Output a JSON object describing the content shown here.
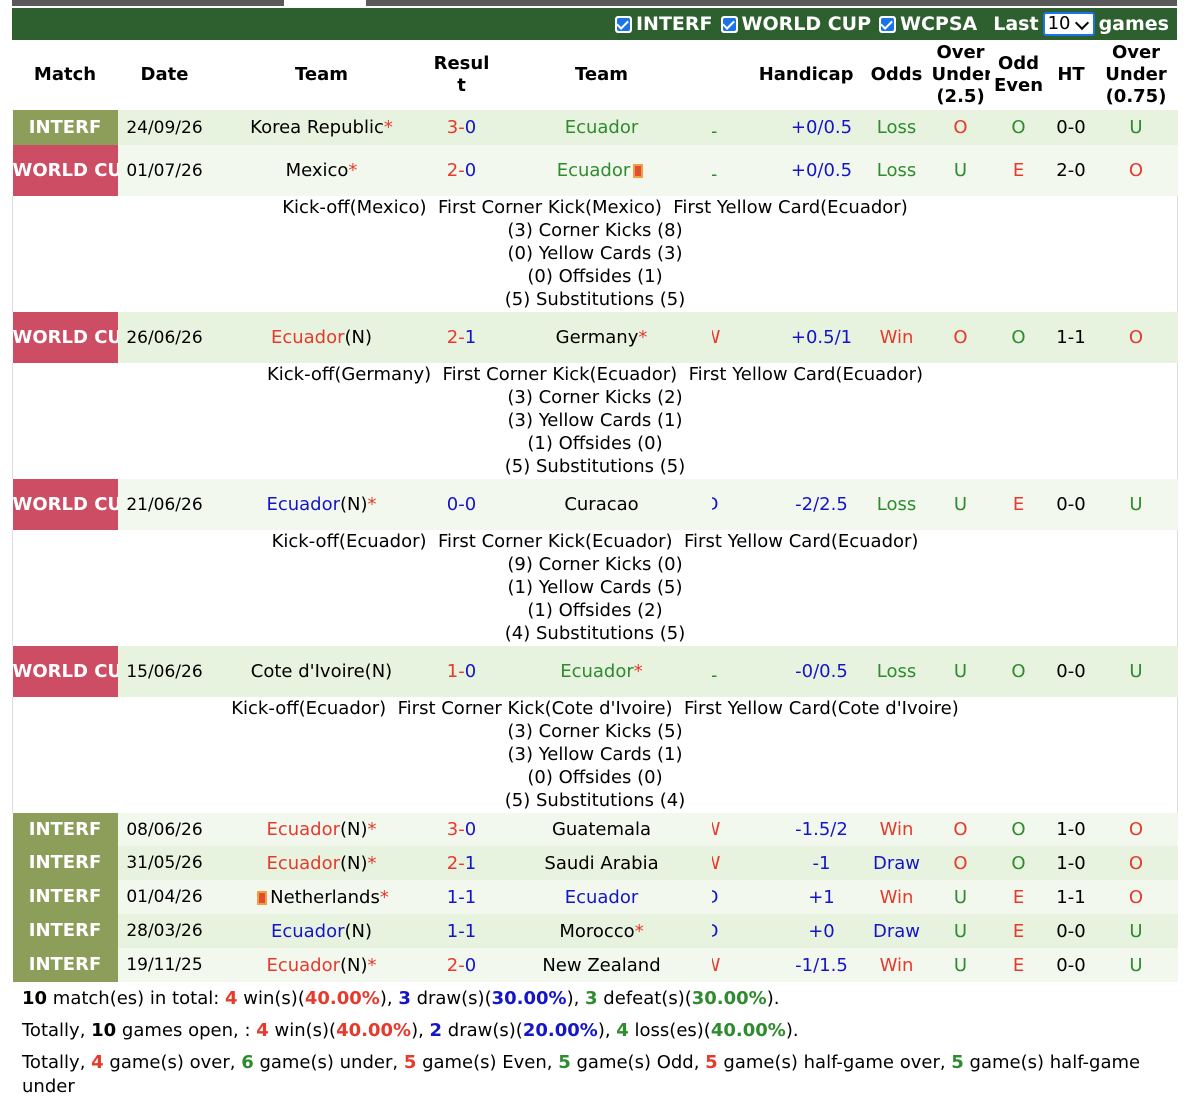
{
  "filters": {
    "items": [
      {
        "label": "INTERF",
        "checked": true
      },
      {
        "label": "WORLD CUP",
        "checked": true
      },
      {
        "label": "WCPSA",
        "checked": true
      }
    ],
    "last_label": "Last",
    "games_count": "10",
    "games_label": "games"
  },
  "headers": {
    "match": "Match",
    "date": "Date",
    "team1": "Team",
    "result": "Resul t",
    "team2": "Team",
    "handicap": "Handicap",
    "odds": "Odds",
    "ou25": "Over Under (2.5)",
    "oddeven": "Odd Even",
    "ht": "HT",
    "ou075": "Over Under (0.75)"
  },
  "rows": [
    {
      "comp": "INTERF",
      "date": "24/09/26",
      "team1": "Korea Republic",
      "team1_star": "*",
      "team1_suffix": "",
      "score_home": "3",
      "score_sep": "-",
      "score_away": "0",
      "team2": "Ecuador",
      "team2_star": "",
      "team2_suffix": "",
      "wl": "L",
      "handicap": "+0/0.5",
      "odds": "Loss",
      "ou": "O",
      "oe": "O",
      "ht": "0-0",
      "ou2": "U",
      "detail": null
    },
    {
      "comp": "WORLD CUP",
      "date": "01/07/26",
      "team1": "Mexico",
      "team1_star": "*",
      "team1_suffix": "",
      "score_home": "2",
      "score_sep": "-",
      "score_away": "0",
      "team2": "Ecuador",
      "team2_star": "",
      "team2_suffix": "",
      "wl": "L",
      "handicap": "+0/0.5",
      "odds": "Loss",
      "ou": "U",
      "oe": "E",
      "ht": "2-0",
      "ou2": "O",
      "detail": [
        "Kick-off(Mexico)  First Corner Kick(Mexico)  First Yellow Card(Ecuador)",
        "(3) Corner Kicks (8)",
        "(0) Yellow Cards (3)",
        "(0) Offsides (1)",
        "(5) Substitutions (5)"
      ]
    },
    {
      "comp": "WORLD CUP",
      "date": "26/06/26",
      "team1": "Ecuador",
      "team1_star": "",
      "team1_suffix": "(N)",
      "score_home": "2",
      "score_sep": "-",
      "score_away": "1",
      "team2": "Germany",
      "team2_star": "*",
      "team2_suffix": "",
      "wl": "W",
      "handicap": "+0.5/1",
      "odds": "Win",
      "ou": "O",
      "oe": "O",
      "ht": "1-1",
      "ou2": "O",
      "detail": [
        "Kick-off(Germany)  First Corner Kick(Ecuador)  First Yellow Card(Ecuador)",
        "(3) Corner Kicks (2)",
        "(3) Yellow Cards (1)",
        "(1) Offsides (0)",
        "(5) Substitutions (5)"
      ]
    },
    {
      "comp": "WORLD CUP",
      "date": "21/06/26",
      "team1": "Ecuador",
      "team1_star": "*",
      "team1_suffix": "(N)",
      "score_home": "0",
      "score_sep": "-",
      "score_away": "0",
      "team2": "Curacao",
      "team2_star": "",
      "team2_suffix": "",
      "wl": "D",
      "handicap": "-2/2.5",
      "odds": "Loss",
      "ou": "U",
      "oe": "E",
      "ht": "0-0",
      "ou2": "U",
      "detail": [
        "Kick-off(Ecuador)  First Corner Kick(Ecuador)  First Yellow Card(Ecuador)",
        "(9) Corner Kicks (0)",
        "(1) Yellow Cards (5)",
        "(1) Offsides (2)",
        "(4) Substitutions (5)"
      ]
    },
    {
      "comp": "WORLD CUP",
      "date": "15/06/26",
      "team1": "Cote d'Ivoire",
      "team1_star": "",
      "team1_suffix": "(N)",
      "score_home": "1",
      "score_sep": "-",
      "score_away": "0",
      "team2": "Ecuador",
      "team2_star": "*",
      "team2_suffix": "",
      "wl": "L",
      "handicap": "-0/0.5",
      "odds": "Loss",
      "ou": "U",
      "oe": "O",
      "ht": "0-0",
      "ou2": "U",
      "detail": [
        "Kick-off(Ecuador)  First Corner Kick(Cote d'Ivoire)  First Yellow Card(Cote d'Ivoire)",
        "(3) Corner Kicks (5)",
        "(3) Yellow Cards (1)",
        "(0) Offsides (0)",
        "(5) Substitutions (4)"
      ]
    },
    {
      "comp": "INTERF",
      "date": "08/06/26",
      "team1": "Ecuador",
      "team1_star": "*",
      "team1_suffix": "(N)",
      "score_home": "3",
      "score_sep": "-",
      "score_away": "0",
      "team2": "Guatemala",
      "team2_star": "",
      "team2_suffix": "",
      "wl": "W",
      "handicap": "-1.5/2",
      "odds": "Win",
      "ou": "O",
      "oe": "O",
      "ht": "1-0",
      "ou2": "O",
      "detail": null
    },
    {
      "comp": "INTERF",
      "date": "31/05/26",
      "team1": "Ecuador",
      "team1_star": "*",
      "team1_suffix": "(N)",
      "score_home": "2",
      "score_sep": "-",
      "score_away": "1",
      "team2": "Saudi Arabia",
      "team2_star": "",
      "team2_suffix": "",
      "wl": "W",
      "handicap": "-1",
      "odds": "Draw",
      "ou": "O",
      "oe": "O",
      "ht": "1-0",
      "ou2": "O",
      "detail": null
    },
    {
      "comp": "INTERF",
      "date": "01/04/26",
      "team1": "Netherlands",
      "team1_star": "*",
      "team1_suffix": "",
      "score_home": "1",
      "score_sep": "-",
      "score_away": "1",
      "team2": "Ecuador",
      "team2_star": "",
      "team2_suffix": "",
      "wl": "D",
      "handicap": "+1",
      "odds": "Win",
      "ou": "U",
      "oe": "E",
      "ht": "1-1",
      "ou2": "O",
      "detail": null
    },
    {
      "comp": "INTERF",
      "date": "28/03/26",
      "team1": "Ecuador",
      "team1_star": "",
      "team1_suffix": "(N)",
      "score_home": "1",
      "score_sep": "-",
      "score_away": "1",
      "team2": "Morocco",
      "team2_star": "*",
      "team2_suffix": "",
      "wl": "D",
      "handicap": "+0",
      "odds": "Draw",
      "ou": "U",
      "oe": "E",
      "ht": "0-0",
      "ou2": "U",
      "detail": null
    },
    {
      "comp": "INTERF",
      "date": "19/11/25",
      "team1": "Ecuador",
      "team1_star": "*",
      "team1_suffix": "(N)",
      "score_home": "2",
      "score_sep": "-",
      "score_away": "0",
      "team2": "New Zealand",
      "team2_star": "",
      "team2_suffix": "",
      "wl": "W",
      "handicap": "-1/1.5",
      "odds": "Win",
      "ou": "U",
      "oe": "E",
      "ht": "0-0",
      "ou2": "U",
      "detail": null
    }
  ],
  "summary": {
    "line1": {
      "total": "10",
      "t1": " match(es) in total: ",
      "wins": "4",
      "t2": " win(s)(",
      "win_pct": "40.00%",
      "t3": "), ",
      "draws": "3",
      "t4": " draw(s)(",
      "draw_pct": "30.00%",
      "t5": "), ",
      "defeats": "3",
      "t6": " defeat(s)(",
      "defeat_pct": "30.00%",
      "t7": ")."
    },
    "line2": {
      "t0": "Totally, ",
      "total": "10",
      "t1": " games open, : ",
      "wins": "4",
      "t2": " win(s)(",
      "win_pct": "40.00%",
      "t3": "), ",
      "draws": "2",
      "t4": " draw(s)(",
      "draw_pct": "20.00%",
      "t5": "), ",
      "losses": "4",
      "t6": " loss(es)(",
      "loss_pct": "40.00%",
      "t7": ")."
    },
    "line3": {
      "t0": "Totally, ",
      "over": "4",
      "t1": " game(s) over, ",
      "under": "6",
      "t2": " game(s) under, ",
      "even": "5",
      "t3": " game(s) Even, ",
      "odd": "5",
      "t4": " game(s) Odd, ",
      "hover": "5",
      "t5": " game(s) half-game over, ",
      "hunder": "5",
      "t6": " game(s) half-game under"
    }
  }
}
